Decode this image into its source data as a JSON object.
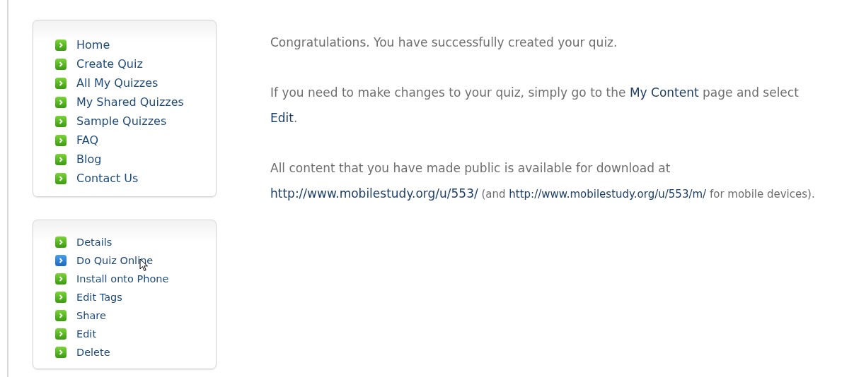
{
  "main_menu": [
    {
      "label": "Home",
      "hovered": false
    },
    {
      "label": "Create Quiz",
      "hovered": false
    },
    {
      "label": "All My Quizzes",
      "hovered": false
    },
    {
      "label": "My Shared Quizzes",
      "hovered": false
    },
    {
      "label": "Sample Quizzes",
      "hovered": false
    },
    {
      "label": "FAQ",
      "hovered": false
    },
    {
      "label": "Blog",
      "hovered": false
    },
    {
      "label": "Contact Us",
      "hovered": false
    }
  ],
  "quiz_menu": [
    {
      "label": "Details",
      "hovered": false
    },
    {
      "label": "Do Quiz Online",
      "hovered": true
    },
    {
      "label": "Install onto Phone",
      "hovered": false
    },
    {
      "label": "Edit Tags",
      "hovered": false
    },
    {
      "label": "Share",
      "hovered": false
    },
    {
      "label": "Edit",
      "hovered": false
    },
    {
      "label": "Delete",
      "hovered": false
    }
  ],
  "paragraphs": [
    [
      {
        "kind": "text",
        "text": "Congratulations. You have successfully created your quiz."
      }
    ],
    [
      {
        "kind": "text",
        "text": "If you need to make changes to your quiz, simply go to the "
      },
      {
        "kind": "link",
        "text": "My Content"
      },
      {
        "kind": "text",
        "text": " page and select "
      },
      {
        "kind": "link",
        "text": "Edit"
      },
      {
        "kind": "text",
        "text": "."
      }
    ],
    [
      {
        "kind": "text",
        "text": "All content that you have made public is available for download at "
      },
      {
        "kind": "link",
        "text": "http://www.mobilestudy.org/u/553/"
      },
      {
        "kind": "note",
        "text": " (and "
      },
      {
        "kind": "note_link",
        "text": "http://www.mobilestudy.org/u/553/m/"
      },
      {
        "kind": "note",
        "text": " for mobile devices)."
      }
    ]
  ]
}
